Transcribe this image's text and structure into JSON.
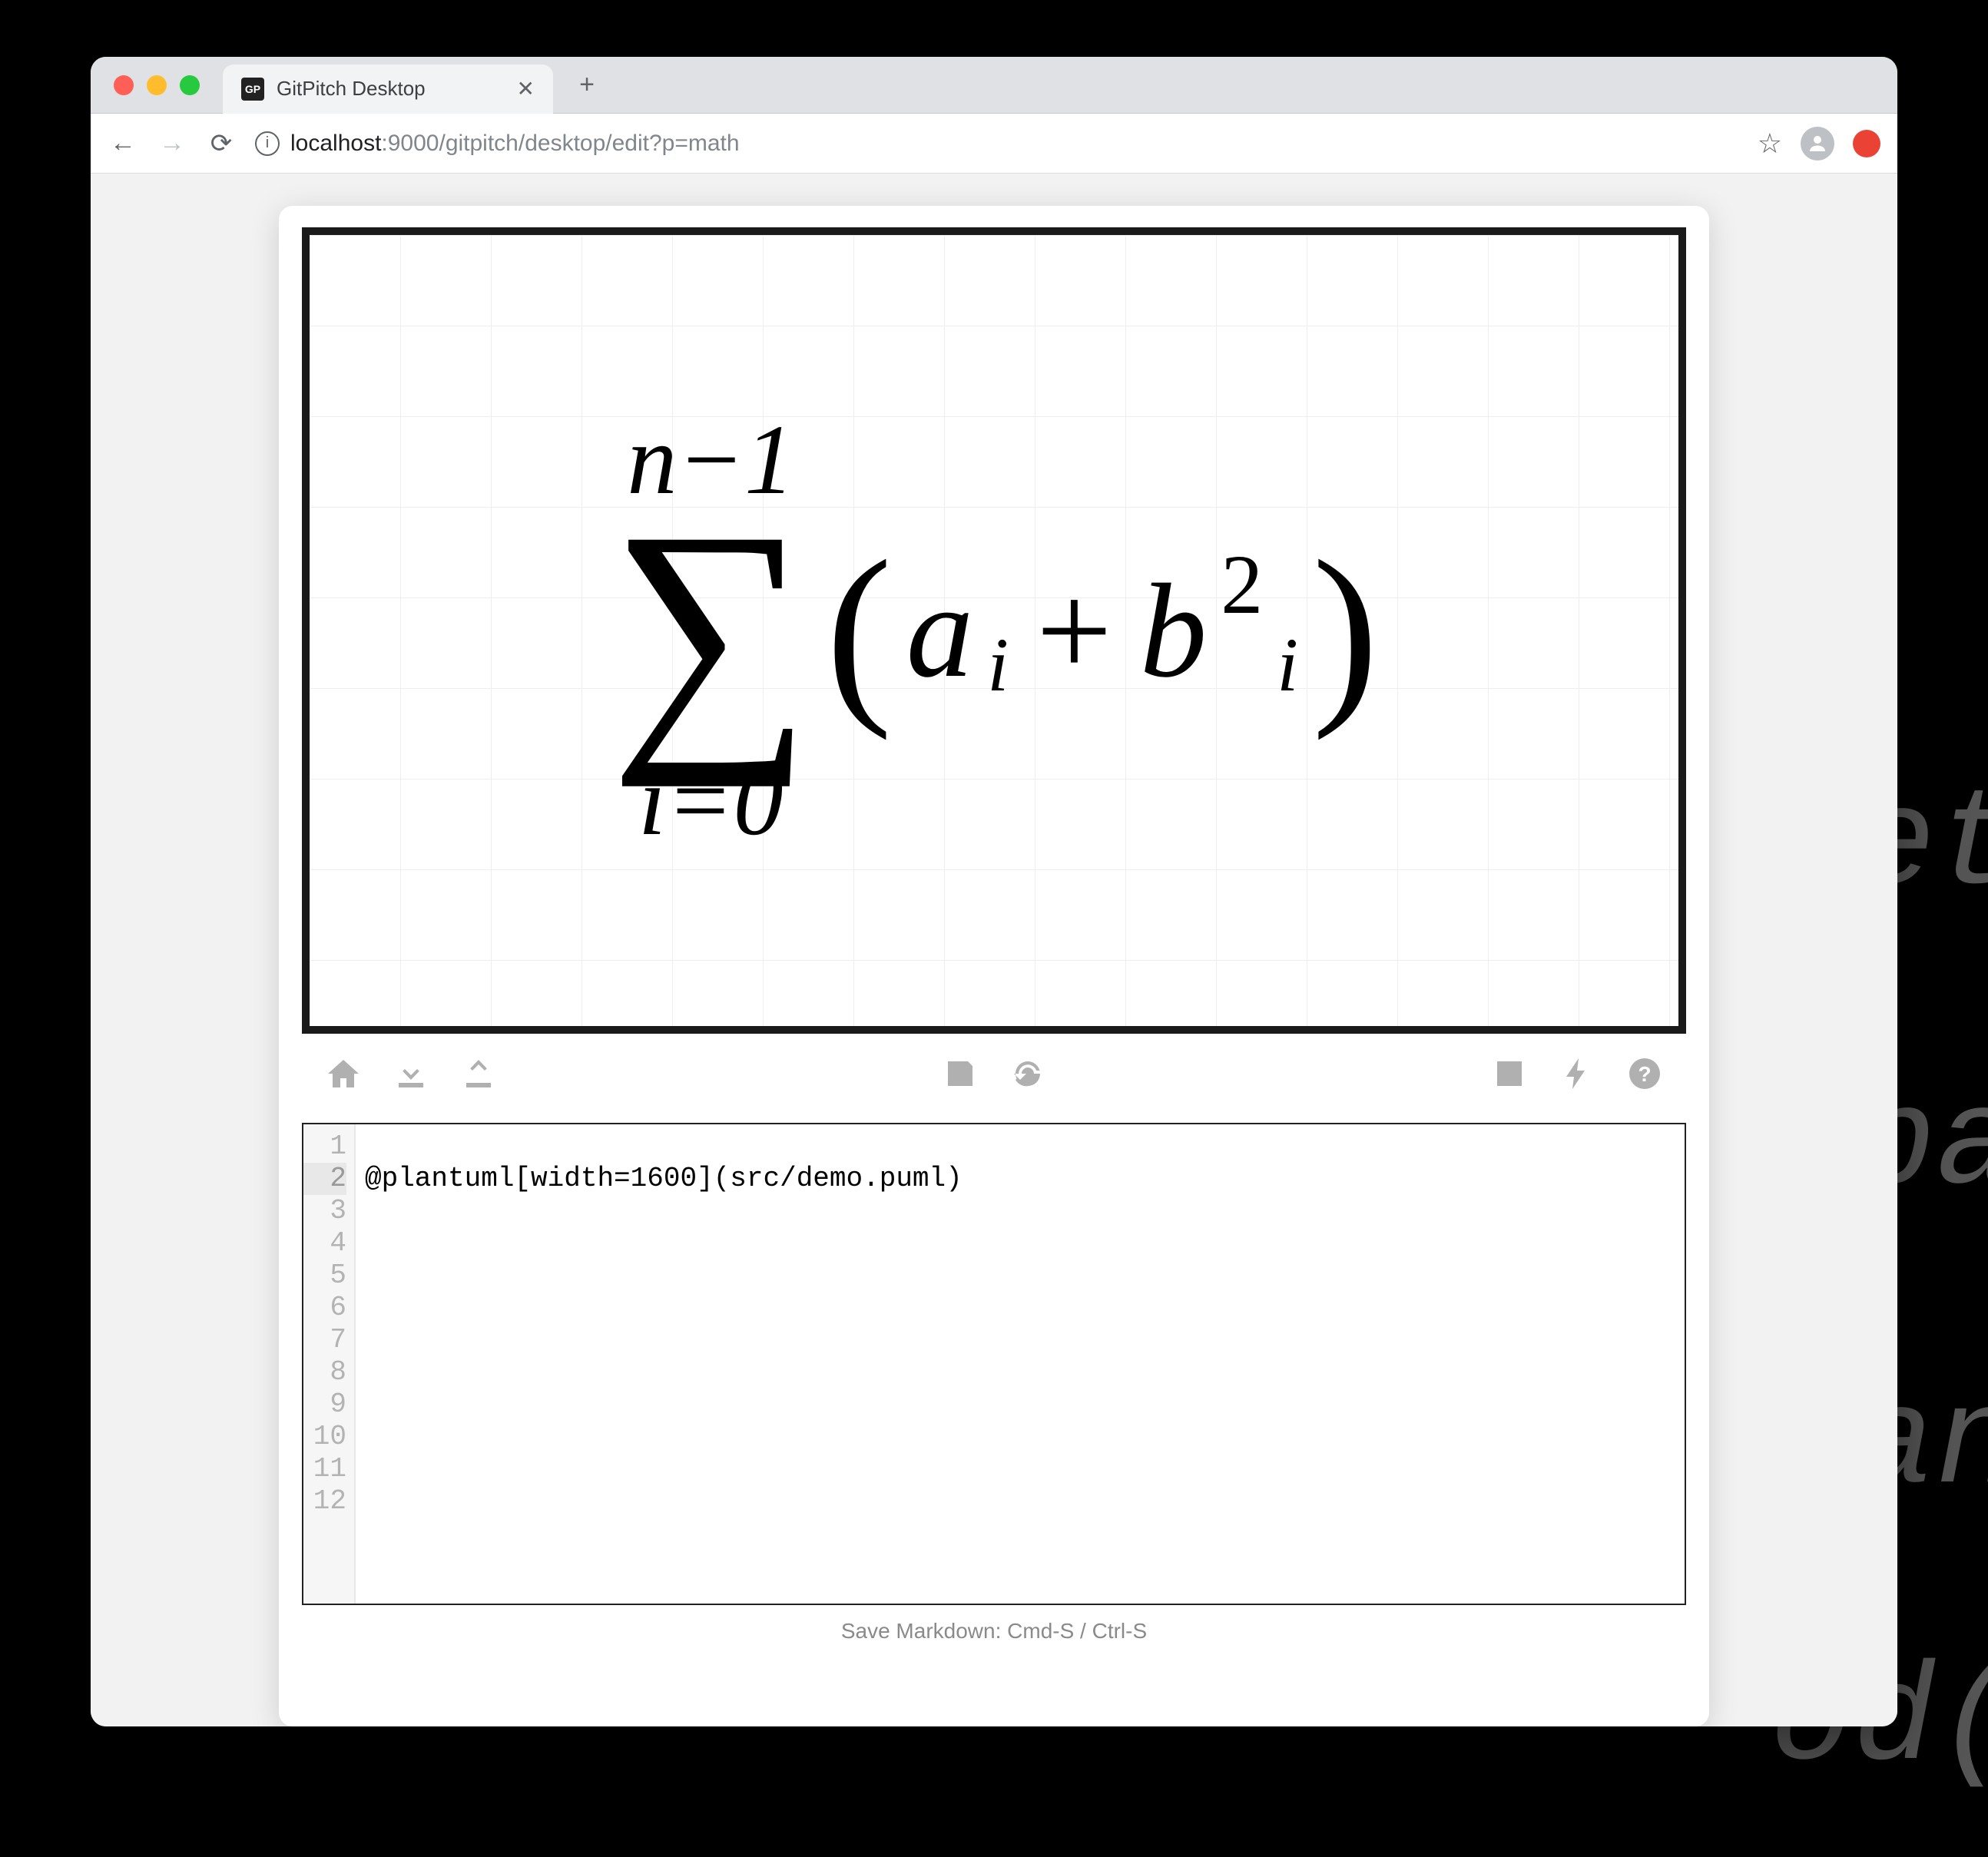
{
  "browser": {
    "tab_title": "GitPitch Desktop",
    "favicon_text": "GP",
    "url_host": "localhost",
    "url_port_path": ":9000/gitpitch/desktop/edit?p=math"
  },
  "preview": {
    "formula": {
      "upper": "n−1",
      "lower": "i=0",
      "a_var": "a",
      "a_sub": "i",
      "b_var": "b",
      "b_sub": "i",
      "b_sup": "2"
    }
  },
  "toolbar": {
    "home": "home-icon",
    "download": "download-icon",
    "upload": "upload-icon",
    "save": "save-icon",
    "refresh": "refresh-icon",
    "image": "image-icon",
    "lightning": "lightning-icon",
    "help": "help-icon"
  },
  "editor": {
    "line_count": 12,
    "current_line": 2,
    "lines": [
      "",
      "@plantuml[width=1600](src/demo.puml)",
      "",
      "",
      "",
      "",
      "",
      "",
      "",
      "",
      "",
      ""
    ]
  },
  "status_text": "Save Markdown: Cmd-S / Ctrl-S"
}
